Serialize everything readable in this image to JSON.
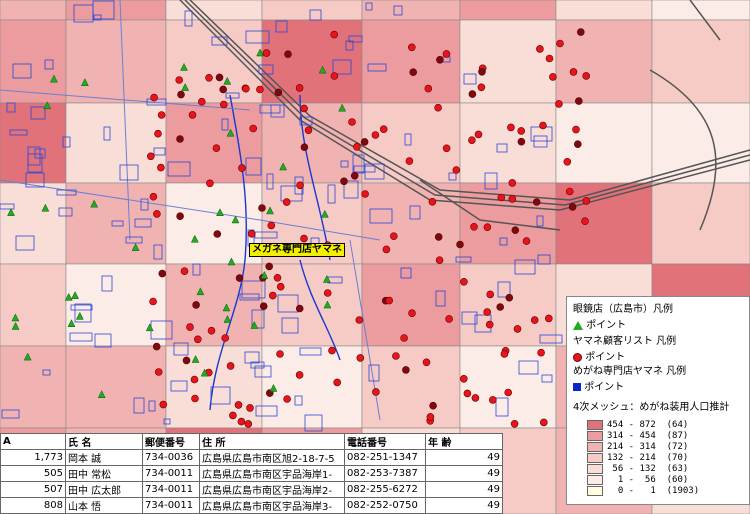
{
  "shop_label": "メガネ専門店ヤマネ",
  "legend": {
    "shops_title": "眼鏡店（広島市）凡例",
    "point_label": "ポイント",
    "customers_title": "ヤマネ顧客リスト 凡例",
    "customers_point": "ポイント",
    "store_title": "めがね専門店ヤマネ 凡例",
    "store_point": "ポイント",
    "mesh_title": "4次メッシュ：めがね装用人口推計",
    "mesh_classes": [
      {
        "range": "454 - 872",
        "count": "(64)",
        "color": "#e2727a"
      },
      {
        "range": "314 - 454",
        "count": "(87)",
        "color": "#ec9c9e"
      },
      {
        "range": "214 - 314",
        "count": "(72)",
        "color": "#f1b3b1"
      },
      {
        "range": "132 - 214",
        "count": "(70)",
        "color": "#f6cbc6"
      },
      {
        "range": " 56 - 132",
        "count": "(63)",
        "color": "#f9ddd7"
      },
      {
        "range": "  1 -  56",
        "count": "(60)",
        "color": "#fcece7"
      },
      {
        "range": "  0 -   1",
        "count": "(1903)",
        "color": "#ffffe0"
      }
    ]
  },
  "table": {
    "headers": [
      "A",
      "氏 名",
      "郵便番号",
      "住 所",
      "電話番号",
      "年 齢"
    ],
    "rows": [
      [
        "1,773",
        "岡本 誠",
        "734-0036",
        "広島県広島市南区旭2-18-7-5",
        "082-251-1347",
        "49"
      ],
      [
        "505",
        "田中 常松",
        "734-0011",
        "広島県広島市南区宇品海岸1-",
        "082-253-7387",
        "49"
      ],
      [
        "507",
        "田中 広太郎",
        "734-0011",
        "広島県広島市南区宇品海岸2-",
        "082-255-6272",
        "49"
      ],
      [
        "808",
        "山本 悟",
        "734-0011",
        "広島県広島市南区宇品海岸3-",
        "082-252-0750",
        "49"
      ]
    ]
  }
}
